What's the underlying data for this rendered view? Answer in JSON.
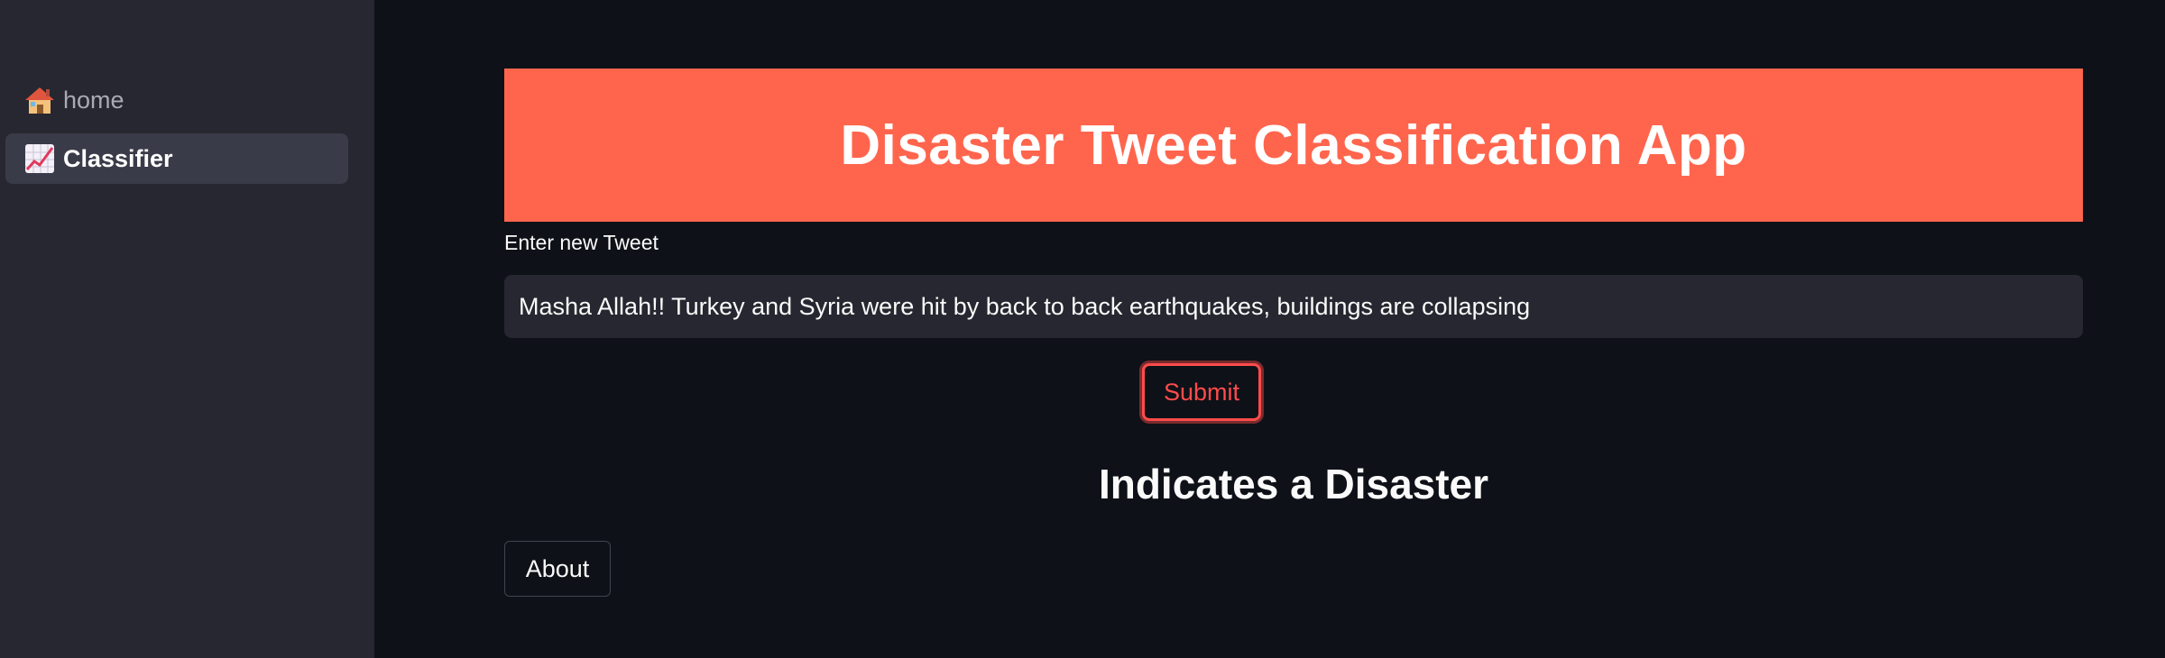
{
  "sidebar": {
    "items": [
      {
        "icon": "house-icon",
        "label": "home",
        "active": false
      },
      {
        "icon": "chart-increasing-icon",
        "label": "Classifier",
        "active": true
      }
    ]
  },
  "main": {
    "banner_title": "Disaster Tweet Classification App",
    "banner_color": "#ff654d",
    "input_label": "Enter new Tweet",
    "tweet_value": "Masha Allah!! Turkey and Syria were hit by back to back earthquakes, buildings are collapsing",
    "submit_label": "Submit",
    "result_text": "Indicates a Disaster",
    "about_label": "About"
  },
  "colors": {
    "background": "#0e1117",
    "sidebar": "#262730",
    "accent": "#ff4b4b"
  }
}
